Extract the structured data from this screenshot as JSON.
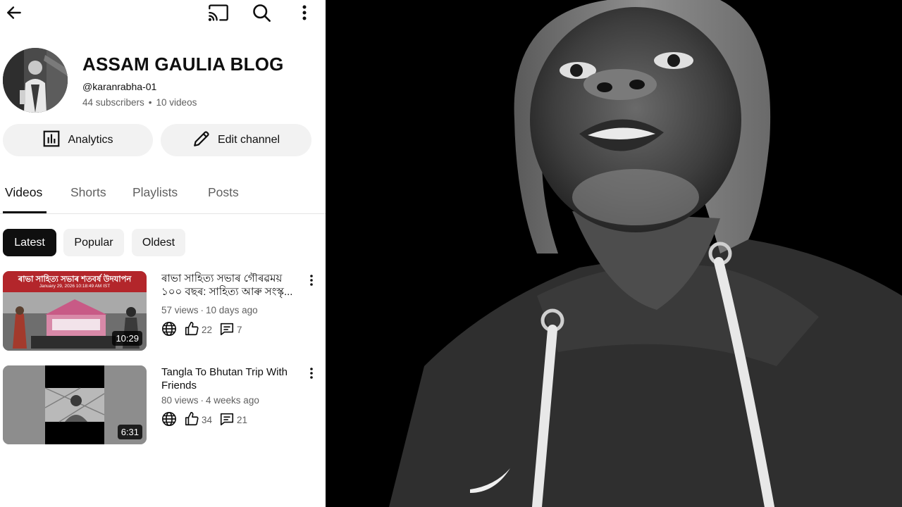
{
  "header": {
    "back_icon": "arrow-left-icon",
    "cast_icon": "cast-icon",
    "search_icon": "search-icon",
    "more_icon": "more-vertical-icon"
  },
  "channel": {
    "title": "ASSAM GAULIA BLOG",
    "handle": "@karanrabha-01",
    "subscribers": "44 subscribers",
    "videos_count": "10 videos"
  },
  "actions": {
    "analytics_label": "Analytics",
    "edit_label": "Edit channel"
  },
  "tabs": [
    {
      "label": "Videos",
      "active": true
    },
    {
      "label": "Shorts",
      "active": false
    },
    {
      "label": "Playlists",
      "active": false
    },
    {
      "label": "Posts",
      "active": false
    }
  ],
  "filters": [
    {
      "label": "Latest",
      "active": true
    },
    {
      "label": "Popular",
      "active": false
    },
    {
      "label": "Oldest",
      "active": false
    }
  ],
  "videos": [
    {
      "title": "ৰাভা সাহিত্য সভাৰ গৌৰৱময় ১০০ বছৰ: সাহিত্য আৰু সংস্কৃ...",
      "views": "57 views",
      "age": "10 days ago",
      "likes": "22",
      "comments": "7",
      "duration": "10:29",
      "thumb_banner": "ৰাভা সাহিত্য সভাৰ শতবৰ্ষ উদযাপন",
      "thumb_date": "January 29, 2026 10:18:49 AM IST"
    },
    {
      "title": "Tangla To Bhutan Trip With Friends",
      "views": "80 views",
      "age": "4 weeks ago",
      "likes": "34",
      "comments": "21",
      "duration": "6:31"
    }
  ],
  "colors": {
    "text_primary": "#0f0f0f",
    "text_secondary": "#606060",
    "chip_bg": "#f2f2f2",
    "banner_red": "#b3262b"
  }
}
